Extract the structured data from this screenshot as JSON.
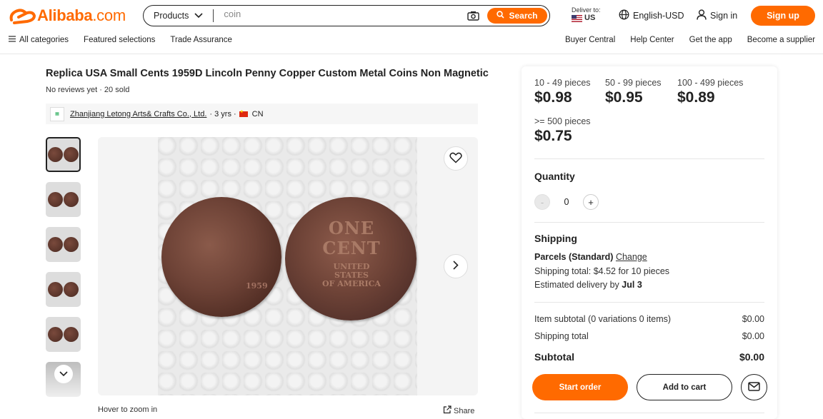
{
  "header": {
    "logo_text": "Alibaba",
    "logo_suffix": ".com",
    "search_category": "Products",
    "search_placeholder": "coin",
    "search_button": "Search",
    "deliver_label": "Deliver to:",
    "deliver_country": "US",
    "language": "English-USD",
    "sign_in": "Sign in",
    "sign_up": "Sign up"
  },
  "nav": {
    "left": [
      "All categories",
      "Featured selections",
      "Trade Assurance"
    ],
    "right": [
      "Buyer Central",
      "Help Center",
      "Get the app",
      "Become a supplier"
    ]
  },
  "product": {
    "title": "Replica USA Small Cents 1959D Lincoln Penny Copper Custom Metal Coins Non Magnetic",
    "reviews": "No reviews yet",
    "sold": "· 20 sold",
    "supplier_name": "Zhanjiang Letong Arts& Crafts Co., Ltd.",
    "supplier_years": "· 3 yrs ·",
    "supplier_country": "CN",
    "coin_front_date": "1959",
    "coin_back_line1": "ONE",
    "coin_back_line2": "CENT",
    "coin_back_line3": "UNITED STATES",
    "coin_back_line4": "OF AMERICA",
    "hover_zoom": "Hover to zoom in",
    "share": "Share"
  },
  "pricing": {
    "tiers": [
      {
        "qty": "10 - 49 pieces",
        "price": "$0.98"
      },
      {
        "qty": "50 - 99 pieces",
        "price": "$0.95"
      },
      {
        "qty": "100 - 499 pieces",
        "price": "$0.89"
      },
      {
        "qty": ">= 500 pieces",
        "price": "$0.75"
      }
    ]
  },
  "quantity": {
    "label": "Quantity",
    "minus": "-",
    "value": "0",
    "plus": "+"
  },
  "shipping": {
    "label": "Shipping",
    "method": "Parcels (Standard)",
    "change": "Change",
    "total_text": "Shipping total: $4.52 for 10 pieces",
    "delivery_prefix": "Estimated delivery by",
    "delivery_date": "Jul 3"
  },
  "summary": {
    "item_subtotal_label": "Item subtotal (0 variations 0 items)",
    "item_subtotal_value": "$0.00",
    "shipping_total_label": "Shipping total",
    "shipping_total_value": "$0.00",
    "subtotal_label": "Subtotal",
    "subtotal_value": "$0.00"
  },
  "actions": {
    "start_order": "Start order",
    "add_to_cart": "Add to cart"
  },
  "colors": {
    "accent": "#ff6a00",
    "text": "#222222"
  }
}
